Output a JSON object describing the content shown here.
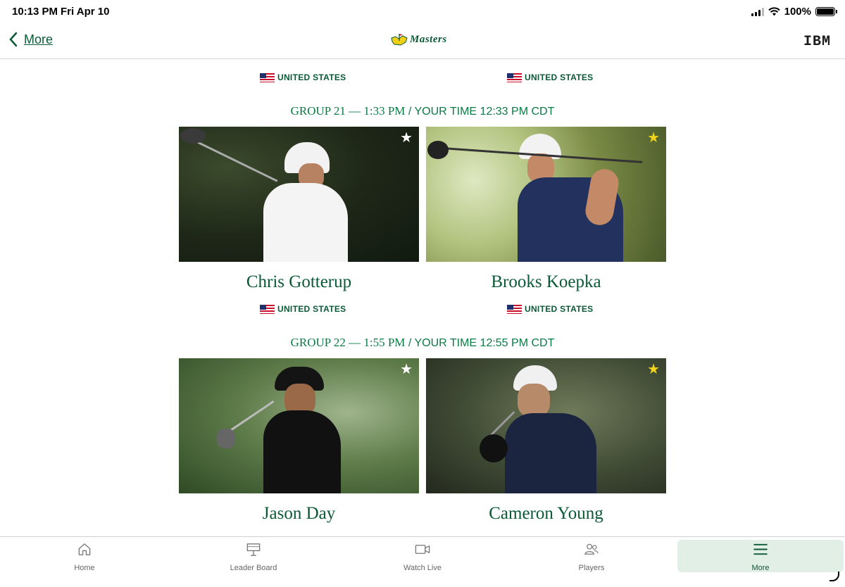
{
  "status_bar": {
    "time": "10:13 PM",
    "date": "Fri Apr 10",
    "battery": "100%"
  },
  "nav": {
    "back_label": "More",
    "logo_text": "Masters",
    "sponsor": "IBM"
  },
  "top_countries": [
    "UNITED STATES",
    "UNITED STATES"
  ],
  "groups": [
    {
      "label": "GROUP 21 — 1:33 PM",
      "your_time": "/ YOUR TIME 12:33 PM CDT",
      "players": [
        {
          "name": "Chris Gotterup",
          "country": "UNITED STATES",
          "favorite": false
        },
        {
          "name": "Brooks Koepka",
          "country": "UNITED STATES",
          "favorite": true
        }
      ]
    },
    {
      "label": "GROUP 22 — 1:55 PM",
      "your_time": "/ YOUR TIME 12:55 PM CDT",
      "players": [
        {
          "name": "Jason Day",
          "country": "",
          "favorite": false
        },
        {
          "name": "Cameron Young",
          "country": "",
          "favorite": true
        }
      ]
    }
  ],
  "tabs": [
    {
      "label": "Home",
      "icon": "home-icon"
    },
    {
      "label": "Leader Board",
      "icon": "leaderboard-icon"
    },
    {
      "label": "Watch Live",
      "icon": "video-icon"
    },
    {
      "label": "Players",
      "icon": "players-icon"
    },
    {
      "label": "More",
      "icon": "menu-icon",
      "active": true
    }
  ],
  "colors": {
    "brand_green": "#0b5a36",
    "group_green": "#0b7a45",
    "favorite_gold": "#f2d21b",
    "active_tab_bg": "#e2efe6"
  }
}
